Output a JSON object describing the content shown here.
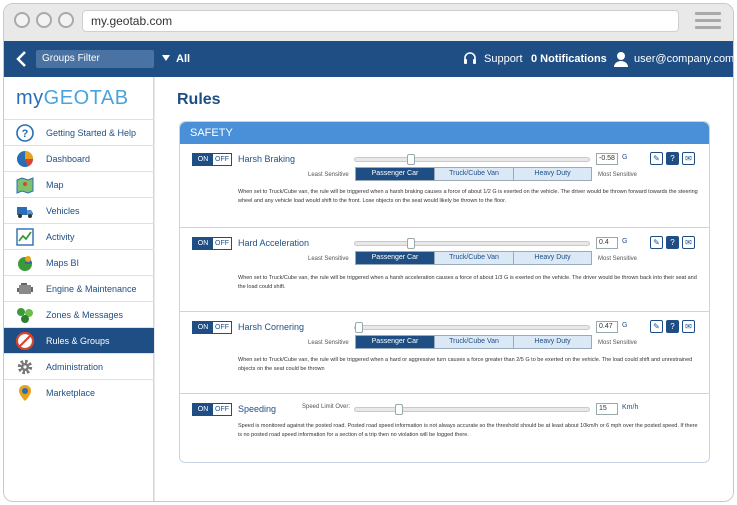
{
  "browser": {
    "url": "my.geotab.com"
  },
  "topbar": {
    "groups_filter": "Groups Filter",
    "all_label": "All",
    "support": "Support",
    "notifications": "0 Notifications",
    "user": "user@company.com"
  },
  "logo": {
    "part1": "my",
    "part2": "GEOTAB"
  },
  "sidebar": {
    "items": [
      {
        "label": "Getting Started & Help",
        "icon": "help-icon"
      },
      {
        "label": "Dashboard",
        "icon": "pie-chart-icon"
      },
      {
        "label": "Map",
        "icon": "map-icon"
      },
      {
        "label": "Vehicles",
        "icon": "truck-icon"
      },
      {
        "label": "Activity",
        "icon": "activity-icon"
      },
      {
        "label": "Maps BI",
        "icon": "maps-bi-icon"
      },
      {
        "label": "Engine & Maintenance",
        "icon": "engine-icon"
      },
      {
        "label": "Zones & Messages",
        "icon": "zones-icon"
      },
      {
        "label": "Rules & Groups",
        "icon": "rules-icon"
      },
      {
        "label": "Administration",
        "icon": "gear-icon"
      },
      {
        "label": "Marketplace",
        "icon": "marketplace-icon"
      }
    ],
    "active_index": 8
  },
  "page": {
    "title": "Rules"
  },
  "panel": {
    "header": "SAFETY"
  },
  "rules": [
    {
      "on": "ON",
      "off": "OFF",
      "name": "Harsh Braking",
      "least": "Least Sensitive",
      "most": "Most Sensitive",
      "value": "-0.58",
      "unit": "G",
      "vehicle_types": [
        "Passenger Car",
        "Truck/Cube Van",
        "Heavy Duty"
      ],
      "selected": 0,
      "desc": "When set to Truck/Cube van, the rule will be triggered when a harsh braking causes a force of about 1/2 G is exerted on the vehicle. The driver would be thrown forward towards the steering wheel and any vehicle load would shift to the front. Lose objects on the seat would likely be thrown to the floor."
    },
    {
      "on": "ON",
      "off": "OFF",
      "name": "Hard Acceleration",
      "least": "Least Sensitive",
      "most": "Most Sensitive",
      "value": "0.4",
      "unit": "G",
      "vehicle_types": [
        "Passenger Car",
        "Truck/Cube Van",
        "Heavy Duty"
      ],
      "selected": 0,
      "desc": "When set to Truck/Cube van, the rule will be triggered when a harsh acceleration causes a force of about 1/3 G is exerted on the vehicle. The driver would be thrown back into their seat and the load could shift."
    },
    {
      "on": "ON",
      "off": "OFF",
      "name": "Harsh Cornering",
      "least": "Least Sensitive",
      "most": "Most Sensitive",
      "value": "0.47",
      "unit": "G",
      "vehicle_types": [
        "Passenger Car",
        "Truck/Cube Van",
        "Heavy Duty"
      ],
      "selected": 0,
      "desc": "When set to Truck/Cube van, the rule will be triggered when a hard or aggressive turn causes a force greater than 2/5 G to be exerted on the vehicle. The load could shift and unrestrained objects on the seat could be thrown"
    }
  ],
  "speeding": {
    "on": "ON",
    "off": "OFF",
    "name": "Speeding",
    "limit_label": "Speed Limit Over:",
    "value": "15",
    "unit": "Km/h",
    "desc": "Speed is monitored against the posted road. Posted road speed information is not always accurate so the threshold should be at least about 10km/h or 6 mph over the posted speed. If there is no posted road speed information for a section of a trip then no violation will be logged there."
  },
  "colors": {
    "brand": "#1f4e85",
    "accent": "#4a90d9"
  }
}
